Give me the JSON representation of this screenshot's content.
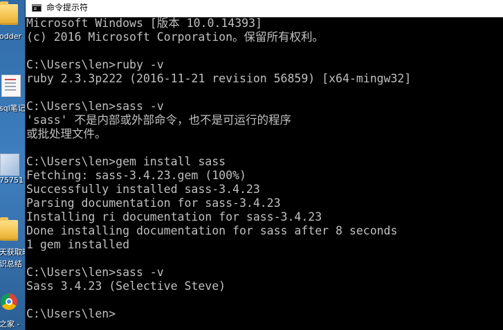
{
  "desktop": {
    "items": [
      {
        "label": "odder",
        "icon": "folder-icon"
      },
      {
        "label": "sql笔记",
        "icon": "document-icon"
      },
      {
        "label": "75751",
        "icon": "image-icon"
      },
      {
        "label": "天获取时",
        "icon": "folder-icon"
      },
      {
        "label": "识总结",
        "icon": ""
      },
      {
        "label": "之家 -",
        "icon": "chrome-icon"
      }
    ]
  },
  "window": {
    "title": "命令提示符",
    "icon": "console-icon"
  },
  "console": {
    "lines": [
      "Microsoft Windows [版本 10.0.14393]",
      "(c) 2016 Microsoft Corporation。保留所有权利。",
      "",
      "C:\\Users\\len>ruby -v",
      "ruby 2.3.3p222 (2016-11-21 revision 56859) [x64-mingw32]",
      "",
      "C:\\Users\\len>sass -v",
      "'sass' 不是内部或外部命令，也不是可运行的程序",
      "或批处理文件。",
      "",
      "C:\\Users\\len>gem install sass",
      "Fetching: sass-3.4.23.gem (100%)",
      "Successfully installed sass-3.4.23",
      "Parsing documentation for sass-3.4.23",
      "Installing ri documentation for sass-3.4.23",
      "Done installing documentation for sass after 8 seconds",
      "1 gem installed",
      "",
      "C:\\Users\\len>sass -v",
      "Sass 3.4.23 (Selective Steve)",
      "",
      "C:\\Users\\len>"
    ]
  },
  "colors": {
    "console_background": "#000000",
    "console_text": "#c0c0c0",
    "titlebar_background": "#ffffff"
  }
}
